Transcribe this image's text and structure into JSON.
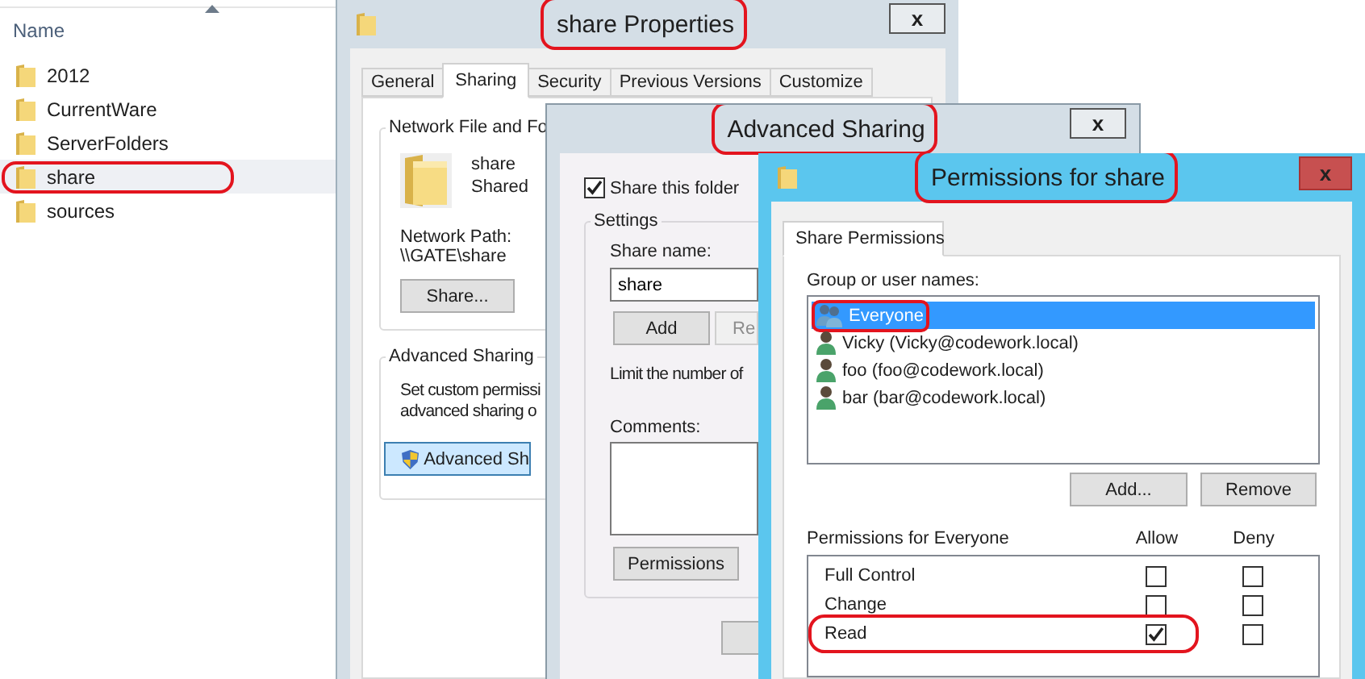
{
  "explorer": {
    "column_header": "Name",
    "items": [
      {
        "name": "2012",
        "selected": false,
        "highlighted": false
      },
      {
        "name": "CurrentWare",
        "selected": false,
        "highlighted": false
      },
      {
        "name": "ServerFolders",
        "selected": false,
        "highlighted": false
      },
      {
        "name": "share",
        "selected": true,
        "highlighted": true
      },
      {
        "name": "sources",
        "selected": false,
        "highlighted": false
      }
    ]
  },
  "properties_window": {
    "title": "share Properties",
    "title_highlighted": true,
    "close": "x",
    "tabs": [
      {
        "label": "General",
        "selected": false
      },
      {
        "label": "Sharing",
        "selected": true
      },
      {
        "label": "Security",
        "selected": false
      },
      {
        "label": "Previous Versions",
        "selected": false
      },
      {
        "label": "Customize",
        "selected": false
      }
    ],
    "network_group": {
      "legend": "Network File and Fo",
      "name": "share",
      "status": "Shared",
      "path_label": "Network Path:",
      "path": "\\\\GATE\\share",
      "button": "Share..."
    },
    "advanced_group": {
      "legend": "Advanced Sharing",
      "lines": [
        "Set custom permissi",
        "advanced sharing o"
      ],
      "button": "Advanced Sh"
    }
  },
  "advanced_window": {
    "title": "Advanced Sharing",
    "title_highlighted": true,
    "close": "x",
    "share_checkbox": {
      "label": "Share this folder",
      "checked": true
    },
    "settings_legend": "Settings",
    "share_name_label": "Share name:",
    "share_name": "share",
    "add_button": "Add",
    "remove_button": {
      "label": "Re",
      "disabled": true
    },
    "limit_text": "Limit the number of",
    "comments_label": "Comments:",
    "permissions_button": "Permissions"
  },
  "permissions_window": {
    "title": "Permissions for share",
    "title_highlighted": true,
    "close": "x",
    "tab": "Share Permissions",
    "users_label": "Group or user names:",
    "users": [
      {
        "name": "Everyone",
        "kind": "group",
        "selected": true,
        "highlighted": true
      },
      {
        "name": "Vicky (Vicky@codework.local)",
        "kind": "user",
        "selected": false,
        "highlighted": false
      },
      {
        "name": "foo (foo@codework.local)",
        "kind": "user",
        "selected": false,
        "highlighted": false
      },
      {
        "name": "bar (bar@codework.local)",
        "kind": "user",
        "selected": false,
        "highlighted": false
      }
    ],
    "add_button": "Add...",
    "remove_button": "Remove",
    "permissions_label": "Permissions for Everyone",
    "allow_header": "Allow",
    "deny_header": "Deny",
    "permissions": [
      {
        "name": "Full Control",
        "allow": false,
        "deny": false,
        "highlighted": false
      },
      {
        "name": "Change",
        "allow": false,
        "deny": false,
        "highlighted": false
      },
      {
        "name": "Read",
        "allow": true,
        "deny": false,
        "highlighted": true
      }
    ]
  }
}
